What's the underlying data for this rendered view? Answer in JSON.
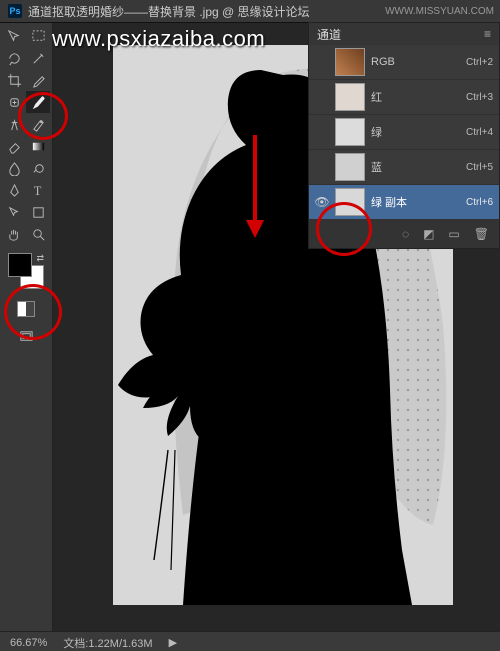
{
  "titlebar": {
    "app": "Ps",
    "title": "通道抠取透明婚纱——替换背景 .jpg @ 思缘设计论坛"
  },
  "watermark": {
    "url": "www.psxiazaiba.com",
    "corner": "WWW.MISSYUAN.COM"
  },
  "channels": {
    "header": "通道",
    "rows": [
      {
        "id": "rgb",
        "label": "RGB",
        "shortcut": "Ctrl+2",
        "eye": false,
        "thumbStyle": "background:linear-gradient(45deg,#c08050,#704020);"
      },
      {
        "id": "red",
        "label": "红",
        "shortcut": "Ctrl+3",
        "eye": false,
        "thumbStyle": "background:#e0d8d0;"
      },
      {
        "id": "green",
        "label": "绿",
        "shortcut": "Ctrl+4",
        "eye": false,
        "thumbStyle": "background:#dcdcdc;"
      },
      {
        "id": "blue",
        "label": "蓝",
        "shortcut": "Ctrl+5",
        "eye": false,
        "thumbStyle": "background:#d0d0d0;"
      },
      {
        "id": "green-copy",
        "label": "绿 副本",
        "shortcut": "Ctrl+6",
        "eye": true,
        "thumbStyle": "background:#d8d8d8;",
        "selected": true
      }
    ],
    "footer": {
      "sel_icon": "select-as-channel",
      "mask_icon": "save-mask",
      "new_icon": "new-channel",
      "trash_icon": "delete-channel"
    }
  },
  "status": {
    "zoom": "66.67%",
    "info": "文档:1.22M/1.63M"
  }
}
